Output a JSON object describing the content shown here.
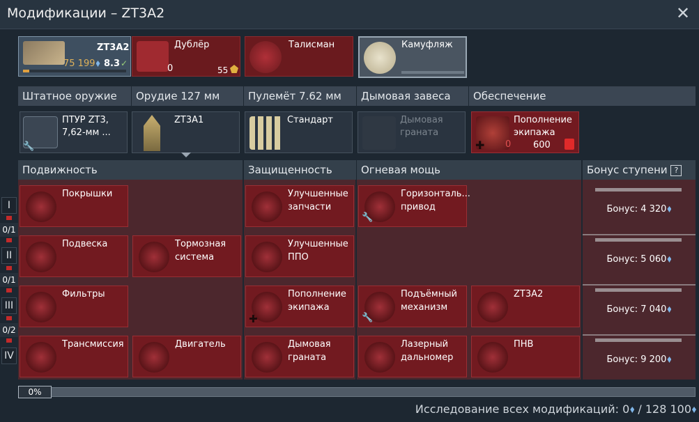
{
  "window": {
    "title": "Модификации – ZT3A2"
  },
  "crew": {
    "vehicle": {
      "name": "ZT3A2",
      "cost": "75 199",
      "br": "8.3"
    },
    "backup": {
      "label": "Дублёр",
      "count": "0",
      "price": "55"
    },
    "talisman": {
      "label": "Талисман"
    },
    "camo": {
      "label": "Камуфляж"
    }
  },
  "weapon_headers": [
    "Штатное оружие",
    "Орудие 127 мм",
    "Пулемёт 7.62 мм",
    "Дымовая завеса",
    "Обеспечение"
  ],
  "weapon_slots": [
    {
      "label": "ПТУР ZT3, 7,62-мм ..."
    },
    {
      "label": "ZT3A1"
    },
    {
      "label": "Стандарт"
    },
    {
      "label": "Дымовая граната"
    },
    {
      "label": "Пополнение экипажа",
      "count": "0",
      "price": "600"
    }
  ],
  "category_headers": [
    "Подвижность",
    "Защищенность",
    "Огневая мощь",
    "Бонус ступени"
  ],
  "tiers": [
    {
      "numeral": "I",
      "count": "0/1"
    },
    {
      "numeral": "II",
      "count": "0/1"
    },
    {
      "numeral": "III",
      "count": "0/2"
    },
    {
      "numeral": "IV"
    }
  ],
  "mods": {
    "tyres": "Покрышки",
    "suspension": "Подвеска",
    "brakes": "Тормозная система",
    "filters": "Фильтры",
    "transmission": "Трансмиссия",
    "engine": "Двигатель",
    "parts": "Улучшенные запчасти",
    "ppo": "Улучшенные ППО",
    "crew_repl": "Пополнение экипажа",
    "smoke": "Дымовая граната",
    "horizontal": "Горизонталь... привод",
    "elevation": "Подъёмный механизм",
    "zt3a2": "ZT3A2",
    "rangefinder": "Лазерный дальномер",
    "nvd": "ПНВ"
  },
  "bonuses": [
    "Бонус: 4 320",
    "Бонус: 5 060",
    "Бонус: 7 040",
    "Бонус: 9 200"
  ],
  "progress": {
    "label": "0%",
    "value": 0
  },
  "footer": {
    "text": "Исследование всех модификаций: 0",
    "total": " / 128 100"
  }
}
